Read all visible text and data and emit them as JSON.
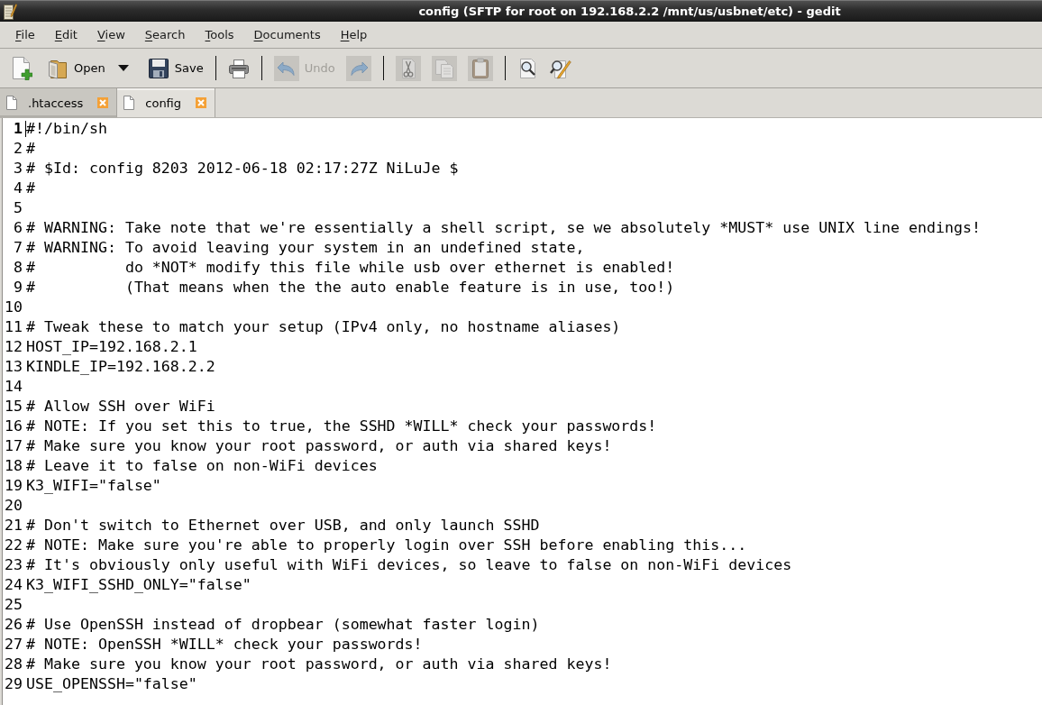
{
  "window": {
    "title": "config (SFTP for root on 192.168.2.2 /mnt/us/usbnet/etc) - gedit"
  },
  "menu_bar": [
    "File",
    "Edit",
    "View",
    "Search",
    "Tools",
    "Documents",
    "Help"
  ],
  "toolbar": [
    {
      "kind": "new",
      "disabled": false
    },
    {
      "kind": "open",
      "label": "Open",
      "disabled": false
    },
    {
      "kind": "save",
      "label": "Save",
      "disabled": false
    },
    {
      "kind": "separator"
    },
    {
      "kind": "print",
      "disabled": false
    },
    {
      "kind": "separator"
    },
    {
      "kind": "undo",
      "label": "Undo",
      "disabled": true
    },
    {
      "kind": "redo",
      "disabled": true
    },
    {
      "kind": "separator"
    },
    {
      "kind": "cut",
      "disabled": true
    },
    {
      "kind": "copy",
      "disabled": true
    },
    {
      "kind": "paste",
      "disabled": true
    },
    {
      "kind": "separator"
    },
    {
      "kind": "find",
      "disabled": false
    },
    {
      "kind": "replace",
      "disabled": false
    }
  ],
  "tabs": [
    {
      "label": ".htaccess",
      "selected": false
    },
    {
      "label": "config",
      "selected": true
    }
  ],
  "editor": {
    "lines": [
      {
        "number": "1",
        "text": "#!/bin/sh",
        "current": true
      },
      {
        "number": "2",
        "text": "#",
        "current": false
      },
      {
        "number": "3",
        "text": "# $Id: config 8203 2012-06-18 02:17:27Z NiLuJe $",
        "current": false
      },
      {
        "number": "4",
        "text": "#",
        "current": false
      },
      {
        "number": "5",
        "current": false
      },
      {
        "number": "6",
        "text": "# WARNING: Take note that we're essentially a shell script, se we absolutely *MUST* use UNIX line endings!",
        "current": false
      },
      {
        "number": "7",
        "text": "# WARNING: To avoid leaving your system in an undefined state,",
        "current": false
      },
      {
        "number": "8",
        "text": "#          do *NOT* modify this file while usb over ethernet is enabled!",
        "current": false
      },
      {
        "number": "9",
        "text": "#          (That means when the the auto enable feature is in use, too!)",
        "current": false
      },
      {
        "number": "10",
        "current": false
      },
      {
        "number": "11",
        "text": "# Tweak these to match your setup (IPv4 only, no hostname aliases)",
        "current": false
      },
      {
        "number": "12",
        "text": "HOST_IP=192.168.2.1",
        "current": false
      },
      {
        "number": "13",
        "text": "KINDLE_IP=192.168.2.2",
        "current": false
      },
      {
        "number": "14",
        "current": false
      },
      {
        "number": "15",
        "text": "# Allow SSH over WiFi",
        "current": false
      },
      {
        "number": "16",
        "text": "# NOTE: If you set this to true, the SSHD *WILL* check your passwords!",
        "current": false
      },
      {
        "number": "17",
        "text": "# Make sure you know your root password, or auth via shared keys!",
        "current": false
      },
      {
        "number": "18",
        "text": "# Leave it to false on non-WiFi devices",
        "current": false
      },
      {
        "number": "19",
        "text": "K3_WIFI=\"false\"",
        "current": false
      },
      {
        "number": "20",
        "current": false
      },
      {
        "number": "21",
        "text": "# Don't switch to Ethernet over USB, and only launch SSHD",
        "current": false
      },
      {
        "number": "22",
        "text": "# NOTE: Make sure you're able to properly login over SSH before enabling this...",
        "current": false
      },
      {
        "number": "23",
        "text": "# It's obviously only useful with WiFi devices, so leave to false on non-WiFi devices",
        "current": false
      },
      {
        "number": "24",
        "text": "K3_WIFI_SSHD_ONLY=\"false\"",
        "current": false
      },
      {
        "number": "25",
        "current": false
      },
      {
        "number": "26",
        "text": "# Use OpenSSH instead of dropbear (somewhat faster login)",
        "current": false
      },
      {
        "number": "27",
        "text": "# NOTE: OpenSSH *WILL* check your passwords!",
        "current": false
      },
      {
        "number": "28",
        "text": "# Make sure you know your root password, or auth via shared keys!",
        "current": false
      },
      {
        "number": "29",
        "text": "USE_OPENSSH=\"false\"",
        "current": false
      }
    ]
  }
}
